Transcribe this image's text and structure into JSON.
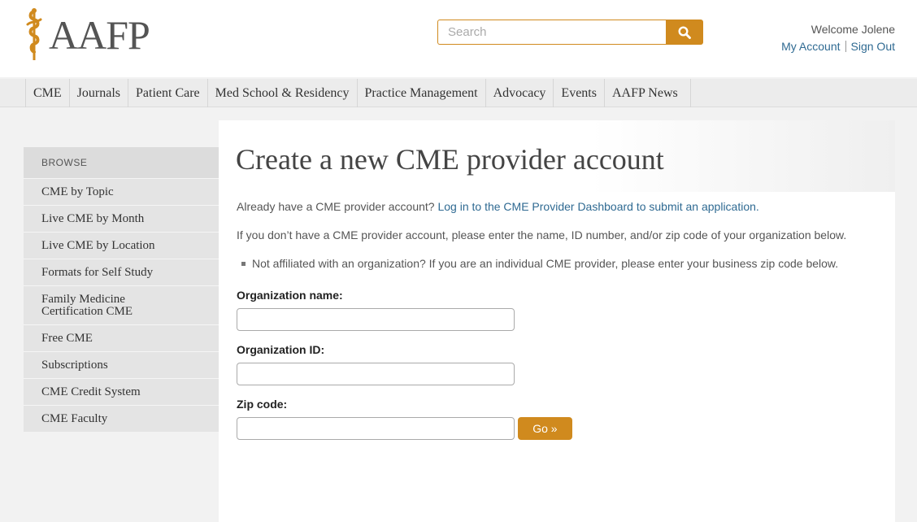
{
  "brand": {
    "logo_text": "AAFP",
    "accent_color": "#d08a1e",
    "link_color": "#2f6a92"
  },
  "search": {
    "placeholder": "Search",
    "button_icon": "search-icon"
  },
  "user": {
    "welcome": "Welcome Jolene",
    "my_account": "My Account",
    "sign_out": "Sign Out"
  },
  "nav": {
    "items": [
      {
        "label": "CME"
      },
      {
        "label": "Journals"
      },
      {
        "label": "Patient Care"
      },
      {
        "label": "Med School & Residency"
      },
      {
        "label": "Practice Management"
      },
      {
        "label": "Advocacy"
      },
      {
        "label": "Events"
      },
      {
        "label": "AAFP News"
      }
    ]
  },
  "sidebar": {
    "heading": "BROWSE",
    "items": [
      {
        "label": "CME by Topic"
      },
      {
        "label": "Live CME by Month"
      },
      {
        "label": "Live CME by Location"
      },
      {
        "label": "Formats for Self Study"
      },
      {
        "label": "Family Medicine\nCertification CME"
      },
      {
        "label": "Free CME"
      },
      {
        "label": "Subscriptions"
      },
      {
        "label": "CME Credit System"
      },
      {
        "label": "CME Faculty"
      }
    ]
  },
  "main": {
    "title": "Create a new CME provider account",
    "intro_text": "Already have a CME provider account?",
    "intro_link": "Log in to the CME Provider Dashboard to submit an application.",
    "instructions": "If you don’t have a CME provider account, please enter the name, ID number, and/or zip code of your organization below.",
    "bullet": "Not affiliated with an organization? If you are an individual CME provider, please enter your business zip code below.",
    "form": {
      "org_name_label": "Organization name:",
      "org_name_value": "",
      "org_id_label": "Organization ID:",
      "org_id_value": "",
      "zip_label": "Zip code:",
      "zip_value": "",
      "submit_label": "Go »"
    }
  }
}
